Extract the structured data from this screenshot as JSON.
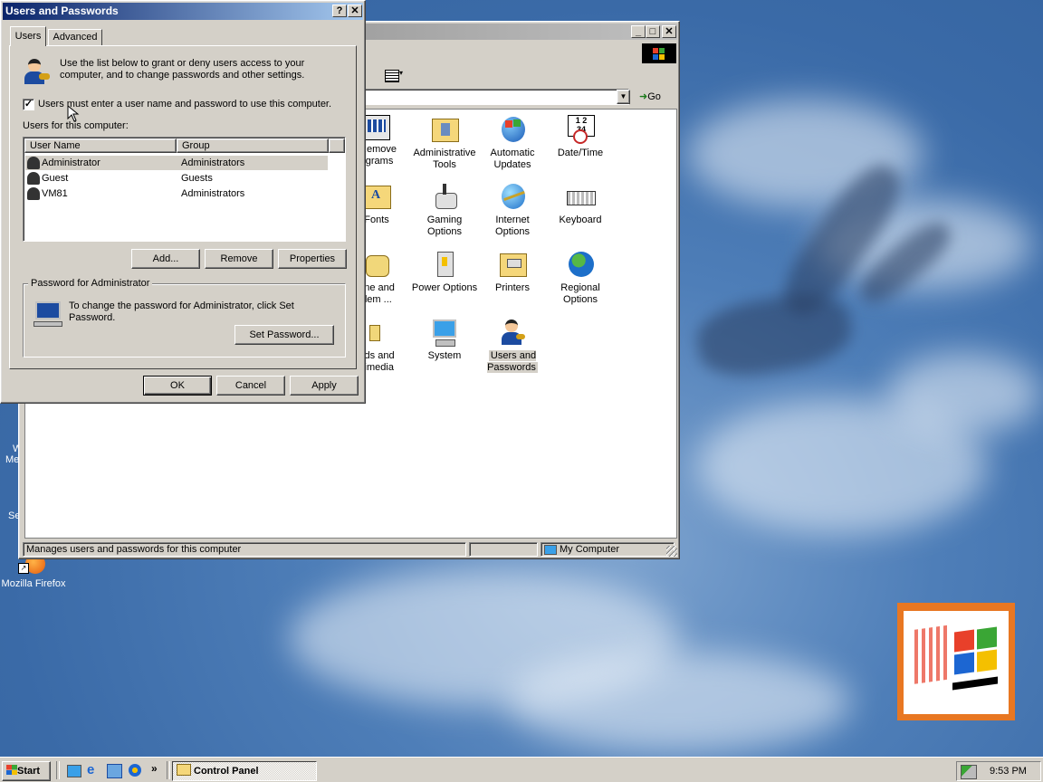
{
  "desktop": {
    "icons": [
      {
        "label": "W",
        "label2": "Me"
      },
      {
        "label": "Se"
      },
      {
        "label": "Mozilla Firefox"
      }
    ]
  },
  "control_panel": {
    "items": [
      {
        "l1": "/Remove",
        "l2": "ograms"
      },
      {
        "l1": "Administrative",
        "l2": "Tools"
      },
      {
        "l1": "Automatic",
        "l2": "Updates"
      },
      {
        "l1": "Date/Time",
        "l2": ""
      },
      {
        "l1": "Fonts",
        "l2": ""
      },
      {
        "l1": "Gaming",
        "l2": "Options"
      },
      {
        "l1": "Internet",
        "l2": "Options"
      },
      {
        "l1": "Keyboard",
        "l2": ""
      },
      {
        "l1": "one and",
        "l2": "dem ..."
      },
      {
        "l1": "Power Options",
        "l2": ""
      },
      {
        "l1": "Printers",
        "l2": ""
      },
      {
        "l1": "Regional",
        "l2": "Options"
      },
      {
        "l1": "nds and",
        "l2": "ltimedia"
      },
      {
        "l1": "System",
        "l2": ""
      },
      {
        "l1": "Users and",
        "l2": "Passwords"
      }
    ],
    "go_label": "Go",
    "status_text": "Manages users and passwords for this computer",
    "status_zone": "My Computer"
  },
  "dialog": {
    "title": "Users and Passwords",
    "help_btn": "?",
    "close_btn": "✕",
    "tabs": [
      "Users",
      "Advanced"
    ],
    "intro": "Use the list below to grant or deny users access to your computer, and to change passwords and other settings.",
    "checkbox_label": "Users must enter a user name and password to use this computer.",
    "checkbox_checked": true,
    "users_label": "Users for this computer:",
    "columns": [
      "User Name",
      "Group"
    ],
    "users": [
      {
        "name": "Administrator",
        "group": "Administrators"
      },
      {
        "name": "Guest",
        "group": "Guests"
      },
      {
        "name": "VM81",
        "group": "Administrators"
      }
    ],
    "add_btn": "Add...",
    "remove_btn": "Remove",
    "properties_btn": "Properties",
    "pw_group_label": "Password for Administrator",
    "pw_text": "To change the password for Administrator, click Set Password.",
    "set_pw_btn": "Set Password...",
    "ok": "OK",
    "cancel": "Cancel",
    "apply": "Apply"
  },
  "taskbar": {
    "start": "Start",
    "chevron": "»",
    "task": "Control Panel",
    "time": "9:53 PM"
  },
  "colors": {
    "title_active": "#0a246a",
    "title_active_end": "#a6caf0",
    "title_inactive": "#808080",
    "face": "#d4d0c8",
    "selection": "#d4d0c8"
  }
}
